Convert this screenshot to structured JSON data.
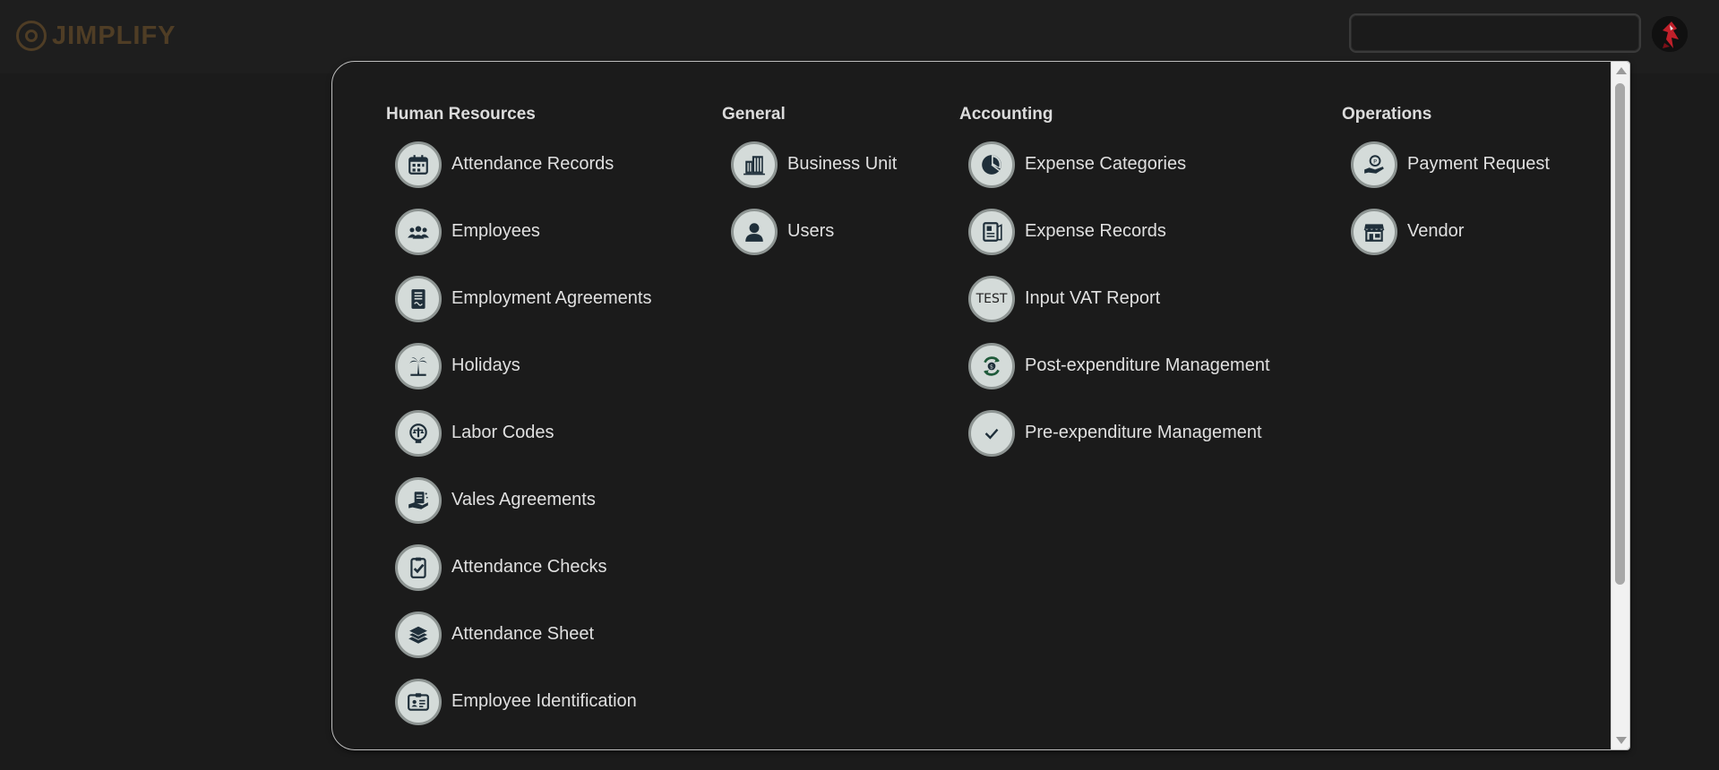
{
  "brand": {
    "name": "JIMPLIFY",
    "color": "#4f3d25"
  },
  "search": {
    "value": "",
    "placeholder": ""
  },
  "menu": {
    "columns": [
      {
        "title": "Human Resources",
        "items": [
          {
            "label": "Attendance Records",
            "icon": "calendar-icon"
          },
          {
            "label": "Employees",
            "icon": "people-icon"
          },
          {
            "label": "Employment Agreements",
            "icon": "contract-icon"
          },
          {
            "label": "Holidays",
            "icon": "palm-tree-icon"
          },
          {
            "label": "Labor Codes",
            "icon": "scales-icon"
          },
          {
            "label": "Vales Agreements",
            "icon": "hand-document-icon"
          },
          {
            "label": "Attendance Checks",
            "icon": "clipboard-check-icon"
          },
          {
            "label": "Attendance Sheet",
            "icon": "stack-sheets-icon"
          },
          {
            "label": "Employee Identification",
            "icon": "id-card-icon"
          }
        ]
      },
      {
        "title": "General",
        "items": [
          {
            "label": "Business Unit",
            "icon": "building-icon"
          },
          {
            "label": "Users",
            "icon": "user-icon"
          }
        ]
      },
      {
        "title": "Accounting",
        "items": [
          {
            "label": "Expense Categories",
            "icon": "pie-chart-icon"
          },
          {
            "label": "Expense Records",
            "icon": "receipt-icon"
          },
          {
            "label": "Input VAT Report",
            "icon": "test-text-icon",
            "icon_text": "TEST"
          },
          {
            "label": "Post-expenditure Management",
            "icon": "money-cycle-icon"
          },
          {
            "label": "Pre-expenditure Management",
            "icon": "check-icon"
          }
        ]
      },
      {
        "title": "Operations",
        "items": [
          {
            "label": "Payment Request",
            "icon": "hand-coin-icon"
          },
          {
            "label": "Vendor",
            "icon": "storefront-icon"
          }
        ]
      }
    ]
  },
  "colors": {
    "background": "#1b1b1b",
    "icon_circle": "#d4dbd9",
    "icon_ink": "#1f2f3a",
    "icon_accent": "#1f5a3a"
  }
}
